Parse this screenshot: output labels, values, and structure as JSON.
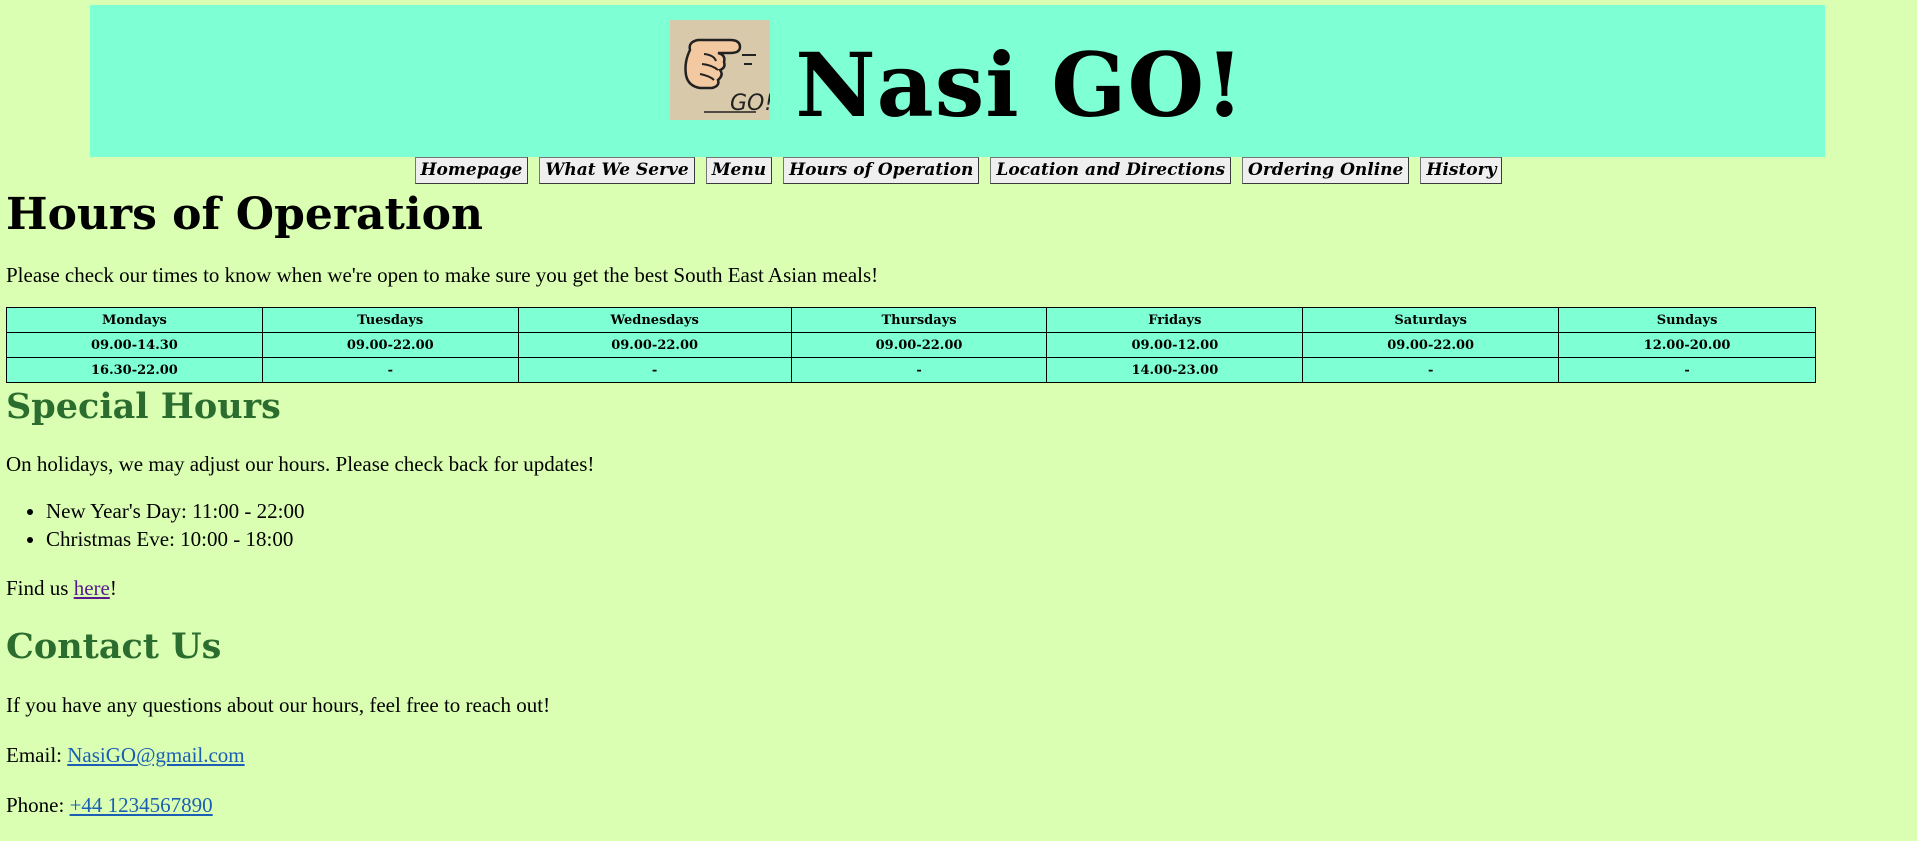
{
  "header": {
    "logo_icon": "pointing-hand-go-icon",
    "logo_text": "GO!",
    "title": "Nasi GO!"
  },
  "nav": {
    "items": [
      {
        "label": "Homepage"
      },
      {
        "label": "What We Serve"
      },
      {
        "label": "Menu"
      },
      {
        "label": "Hours of Operation"
      },
      {
        "label": "Location and Directions"
      },
      {
        "label": "Ordering Online"
      },
      {
        "label": "History"
      }
    ]
  },
  "main": {
    "heading": "Hours of Operation",
    "intro": "Please check our times to know when we're open to make sure you get the best South East Asian meals!",
    "hours_table": {
      "headers": [
        "Mondays",
        "Tuesdays",
        "Wednesdays",
        "Thursdays",
        "Fridays",
        "Saturdays",
        "Sundays"
      ],
      "rows": [
        [
          "09.00-14.30",
          "09.00-22.00",
          "09.00-22.00",
          "09.00-22.00",
          "09.00-12.00",
          "09.00-22.00",
          "12.00-20.00"
        ],
        [
          "16.30-22.00",
          "-",
          "-",
          "-",
          "14.00-23.00",
          "-",
          "-"
        ]
      ]
    },
    "special": {
      "heading": "Special Hours",
      "note": "On holidays, we may adjust our hours. Please check back for updates!",
      "items": [
        "New Year's Day: 11:00 - 22:00",
        "Christmas Eve: 10:00 - 18:00"
      ],
      "find_prefix": "Find us ",
      "find_link": "here",
      "find_suffix": "!"
    },
    "contact": {
      "heading": "Contact Us",
      "intro": "If you have any questions about our hours, feel free to reach out!",
      "email_label": "Email: ",
      "email": "NasiGO@gmail.com",
      "phone_label": "Phone: ",
      "phone": "+44 1234567890"
    }
  },
  "colors": {
    "page_background": "#daffb3",
    "banner_background": "#7fffd4",
    "section_heading": "#2b6c2f",
    "link": "#1a5fb4",
    "visited_link": "#551a8b"
  }
}
